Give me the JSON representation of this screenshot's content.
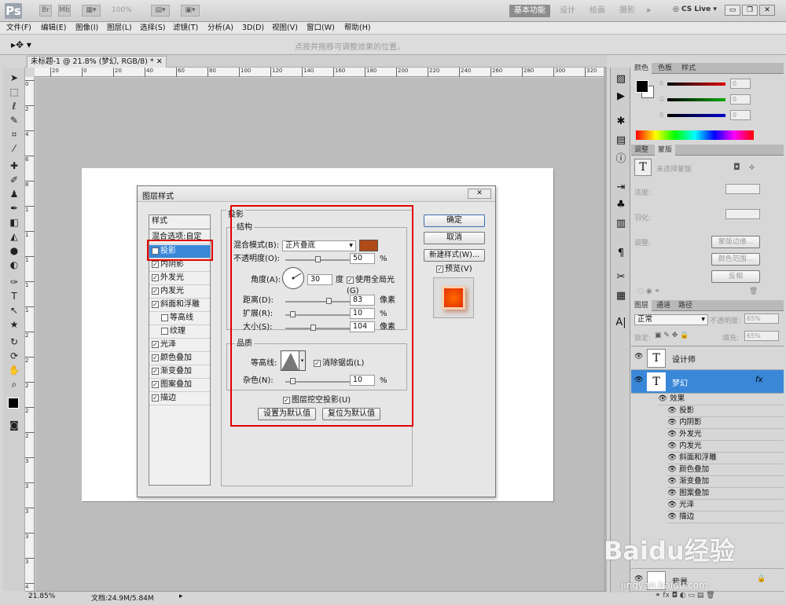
{
  "app": {
    "logo": "Ps",
    "zoom": "100%",
    "workspace": "基本功能",
    "workspaces": [
      "设计",
      "绘画",
      "摄影"
    ],
    "more": "»",
    "cslive": "CS Live"
  },
  "menu": [
    "文件(F)",
    "编辑(E)",
    "图像(I)",
    "图层(L)",
    "选择(S)",
    "滤镜(T)",
    "分析(A)",
    "3D(D)",
    "视图(V)",
    "窗口(W)",
    "帮助(H)"
  ],
  "options": {
    "hint": "点按并拖移可调整效果的位置。"
  },
  "document": {
    "tab": "未标题-1 @ 21.8% (梦幻, RGB/8) *",
    "zoom": "21.85%",
    "info": "文档:24.9M/5.84M",
    "ruler_h": [
      "20",
      "0",
      "20",
      "40",
      "60",
      "80",
      "100",
      "120",
      "140",
      "160",
      "180",
      "200",
      "220",
      "240",
      "260",
      "280",
      "300",
      "320"
    ],
    "ruler_v": [
      "0",
      "2",
      "4",
      "6",
      "8",
      "1",
      "1",
      "1",
      "1",
      "1",
      "2",
      "2",
      "2",
      "2",
      "2",
      "3",
      "3",
      "3",
      "3",
      "3",
      "4"
    ]
  },
  "dialog": {
    "title": "图层样式",
    "styles_header": "样式",
    "blend_options": "混合选项:自定",
    "styles": [
      {
        "label": "投影",
        "checked": true
      },
      {
        "label": "内阴影",
        "checked": true
      },
      {
        "label": "外发光",
        "checked": true
      },
      {
        "label": "内发光",
        "checked": true
      },
      {
        "label": "斜面和浮雕",
        "checked": true
      },
      {
        "label": "等高线",
        "checked": false
      },
      {
        "label": "纹理",
        "checked": false
      },
      {
        "label": "光泽",
        "checked": true
      },
      {
        "label": "颜色叠加",
        "checked": true
      },
      {
        "label": "渐变叠加",
        "checked": true
      },
      {
        "label": "图案叠加",
        "checked": true
      },
      {
        "label": "描边",
        "checked": true
      }
    ],
    "section": "投影",
    "structure": "结构",
    "blend_mode_label": "混合模式(B):",
    "blend_mode": "正片叠底",
    "shadow_color": "#b04a16",
    "opacity_label": "不透明度(O):",
    "opacity": "50",
    "opacity_value": 0.5,
    "pct": "%",
    "angle_label": "角度(A):",
    "angle": "30",
    "deg": "度",
    "global_light": "使用全局光(G)",
    "distance_label": "距离(D):",
    "distance": "83",
    "px": "像素",
    "spread_label": "扩展(R):",
    "spread": "10",
    "size_label": "大小(S):",
    "size": "104",
    "quality": "品质",
    "contour_label": "等高线:",
    "antialias": "消除锯齿(L)",
    "noise_label": "杂色(N):",
    "noise": "10",
    "knockout": "图层挖空投影(U)",
    "make_default": "设置为默认值",
    "reset_default": "复位为默认值",
    "ok": "确定",
    "cancel": "取消",
    "new_style": "新建样式(W)...",
    "preview": "预览(V)"
  },
  "color_panel": {
    "tabs": [
      "颜色",
      "色板",
      "样式"
    ],
    "channels": [
      {
        "name": "R",
        "value": "0"
      },
      {
        "name": "G",
        "value": "0"
      },
      {
        "name": "B",
        "value": "0"
      }
    ]
  },
  "adjust_panel": {
    "tabs": [
      "调整",
      "蒙版"
    ],
    "no_mask": "未选择蒙版",
    "density": "浓度:",
    "feather": "羽化:",
    "refine": "调整:",
    "mask_edge": "蒙版边缘...",
    "color_range": "颜色范围...",
    "invert": "反相"
  },
  "layers_panel": {
    "tabs": [
      "图层",
      "通道",
      "路径"
    ],
    "blend": "正常",
    "opacity_label": "不透明度:",
    "opacity": "65%",
    "lock": "锁定:",
    "fill_label": "填充:",
    "fill": "65%",
    "layers": [
      {
        "name": "设计师",
        "type": "T"
      },
      {
        "name": "梦幻",
        "type": "T",
        "selected": true,
        "fx": "fx"
      }
    ],
    "effects_header": "效果",
    "effects": [
      "投影",
      "内阴影",
      "外发光",
      "内发光",
      "斜面和浮雕",
      "颜色叠加",
      "渐变叠加",
      "图案叠加",
      "光泽",
      "描边"
    ],
    "background": "背景"
  },
  "watermark": {
    "main": "Baidu经验",
    "sub": "jingyan.baidu.com"
  }
}
